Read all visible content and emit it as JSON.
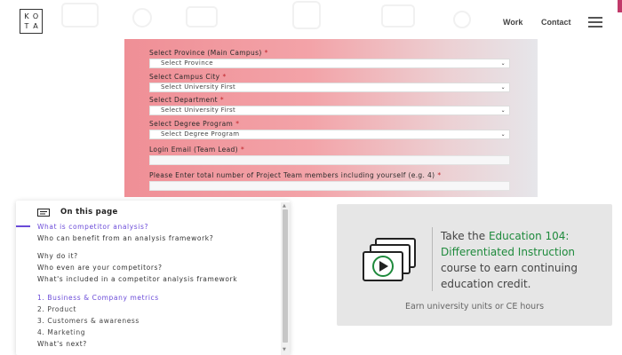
{
  "header": {
    "logo_letters": [
      "K",
      "O",
      "T",
      "A"
    ],
    "nav": {
      "work": "Work",
      "contact": "Contact"
    }
  },
  "form": {
    "fields": [
      {
        "label": "Select Province (Main Campus)",
        "required": "*",
        "type": "select",
        "value": "Select Province"
      },
      {
        "label": "Select Campus City",
        "required": "*",
        "type": "select",
        "value": "Select University First"
      },
      {
        "label": "Select Department",
        "required": "*",
        "type": "select",
        "value": "Select University First"
      },
      {
        "label": "Select Degree Program",
        "required": "*",
        "type": "select",
        "value": "Select Degree Program"
      },
      {
        "label": "Login Email (Team Lead)",
        "required": "*",
        "type": "input",
        "value": ""
      },
      {
        "label": "Please Enter total number of Project Team members including yourself (e.g. 4)",
        "required": "*",
        "type": "input",
        "value": ""
      }
    ]
  },
  "toc": {
    "title": "On this page",
    "items": [
      {
        "text": "What is competitor analysis?",
        "state": "active"
      },
      {
        "text": "Who can benefit from an analysis framework?",
        "state": "normal"
      },
      {
        "text": "Why do it?",
        "state": "normal"
      },
      {
        "text": "Who even are your competitors?",
        "state": "normal"
      },
      {
        "text": "What's included in a competitor analysis framework",
        "state": "normal"
      },
      {
        "text": "1. Business & Company metrics",
        "state": "highlight"
      },
      {
        "text": "2. Product",
        "state": "normal"
      },
      {
        "text": "3. Customers & awareness",
        "state": "normal"
      },
      {
        "text": "4. Marketing",
        "state": "normal"
      },
      {
        "text": "What's next?",
        "state": "normal"
      }
    ]
  },
  "ad": {
    "line_prefix": "Take the ",
    "course": "Education 104: Differentiated Instruction",
    "line_suffix": " course to earn continuing education credit.",
    "footer": "Earn university units or CE hours",
    "accent_color": "#1e8a3c"
  },
  "icons": [
    "hamburger-menu-icon",
    "chevron-down-icon",
    "toc-list-icon",
    "video-stack-play-icon"
  ]
}
